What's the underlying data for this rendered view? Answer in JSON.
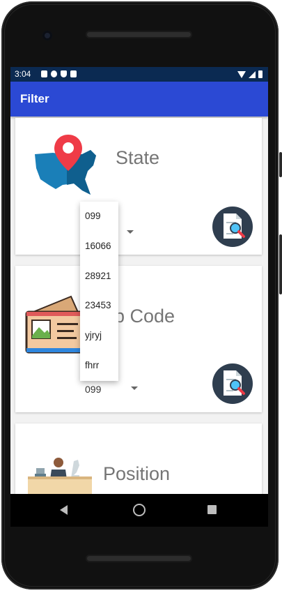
{
  "status_bar": {
    "time": "3:04",
    "icons": [
      "text-icon",
      "settings-icon",
      "shield-icon",
      "sim-icon"
    ],
    "right_icons": [
      "wifi-icon",
      "cellular-icon",
      "battery-icon"
    ]
  },
  "app_bar": {
    "title": "Filter"
  },
  "cards": {
    "state": {
      "title": "State",
      "icon": "us-map-pin-icon",
      "action_icon": "document-search-icon"
    },
    "zip": {
      "title": "Zip Code",
      "visible_title": "p Code",
      "selected": "099",
      "icon": "postcard-icon",
      "action_icon": "document-search-icon"
    },
    "position": {
      "title": "Position",
      "icon": "office-desk-icon"
    }
  },
  "dropdown": {
    "options": [
      "099",
      "16066",
      "28921",
      "23453",
      "yjryj",
      "fhrr"
    ]
  },
  "nav_bar": {
    "icons": [
      "back-icon",
      "home-icon",
      "recents-icon"
    ]
  },
  "colors": {
    "app_bar": "#2b49d4",
    "status_bar": "#0b2a52",
    "search_button": "#2f3e4f",
    "map_blue": "#1a7fb8",
    "pin_red": "#ef3b47"
  }
}
